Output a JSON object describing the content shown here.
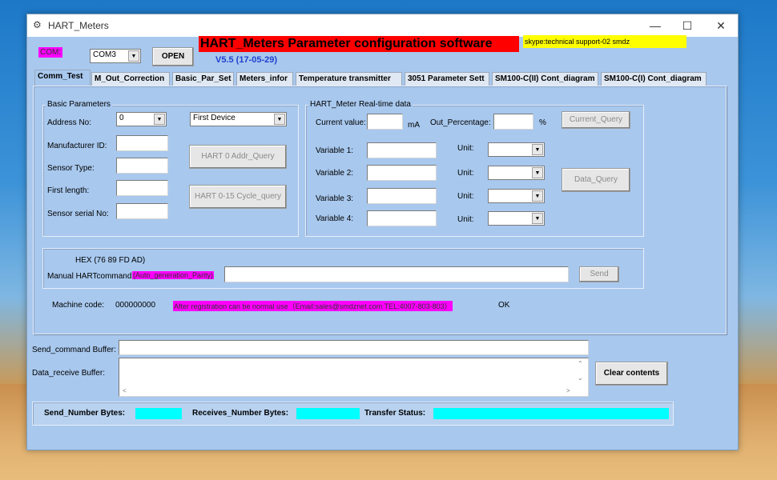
{
  "window": {
    "title": "HART_Meters"
  },
  "top": {
    "com_label": "COM:",
    "com_port": "COM3",
    "open_label": "OPEN",
    "app_title": "HART_Meters Parameter configuration software",
    "version": "V5.5 (17-05-29)",
    "skype": "skype:technical support-02 smdz"
  },
  "tabs": [
    "Comm_Test",
    "M_Out_Correction",
    "Basic_Par_Set",
    "Meters_infor",
    "Temperature transmitter",
    "3051 Parameter Sett",
    "SM100-C(II) Cont_diagram",
    "SM100-C(I) Cont_diagram"
  ],
  "basic": {
    "title": "Basic Parameters",
    "address_label": "Address No:",
    "address_value": "0",
    "device_value": "First Device",
    "manufacturer_label": "Manufacturer ID:",
    "sensor_type_label": "Sensor Type:",
    "first_length_label": "First length:",
    "serial_label": "Sensor serial No:",
    "addr_query_label": "HART 0 Addr_Query",
    "cycle_query_label": "HART 0-15 Cycle_query"
  },
  "realtime": {
    "title": "HART_Meter Real-time data",
    "current_label": "Current value:",
    "ma_unit": "mA",
    "out_pct_label": "Out_Percentage:",
    "pct_unit": "%",
    "current_query_label": "Current_Query",
    "variables": [
      {
        "label": "Variable 1:",
        "unit_label": "Unit:"
      },
      {
        "label": "Variable 2:",
        "unit_label": "Unit:"
      },
      {
        "label": "Variable 3:",
        "unit_label": "Unit:"
      },
      {
        "label": "Variable 4:",
        "unit_label": "Unit:"
      }
    ],
    "data_query_label": "Data_Query"
  },
  "manual": {
    "hex": "HEX (76 89 FD AD)",
    "label": "Manual HARTcommand:",
    "auto_tag": "(Auto_generation_Parity)",
    "send_label": "Send"
  },
  "machine": {
    "label": "Machine code:",
    "code": "000000000",
    "notice": "After registration can be normal use（Email:sales@smdznet.com TEL:4007-803-803）",
    "status": "OK"
  },
  "buffers": {
    "send_label": "Send_command Buffer:",
    "receive_label": "Data_receive Buffer:",
    "clear_label": "Clear contents"
  },
  "status": {
    "send_bytes_label": "Send_Number Bytes:",
    "receive_bytes_label": "Receives_Number Bytes:",
    "transfer_label": "Transfer Status:"
  },
  "colors": {
    "window_bg": "#a8c8ee",
    "title_red": "#ff0000",
    "highlight_magenta": "#ff00ff",
    "highlight_yellow": "#ffff00",
    "status_cyan": "#00ffff",
    "version_blue": "#1f3fd0"
  }
}
